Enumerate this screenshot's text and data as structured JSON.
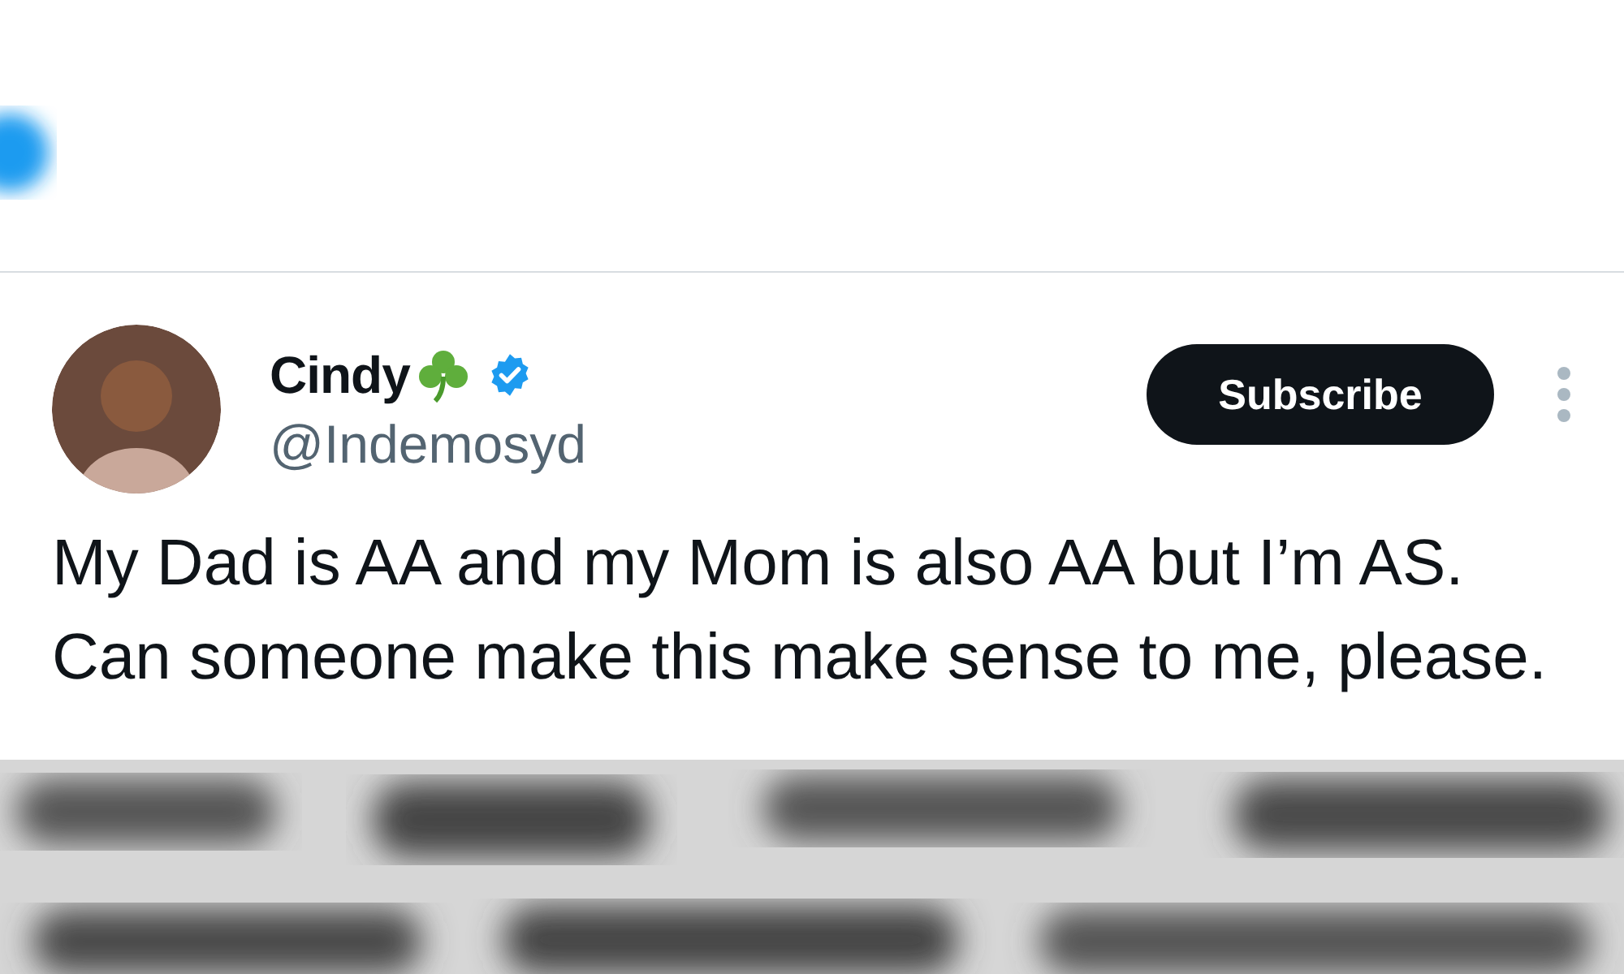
{
  "author": {
    "name": "Cindy",
    "verified": true,
    "handle": "@Indemosyd"
  },
  "subscribe_button": "Subscribe",
  "tweet_text": [
    "My Dad is AA and my Mom is also AA but I’m AS.",
    "Can someone make this make sense to me, please."
  ]
}
